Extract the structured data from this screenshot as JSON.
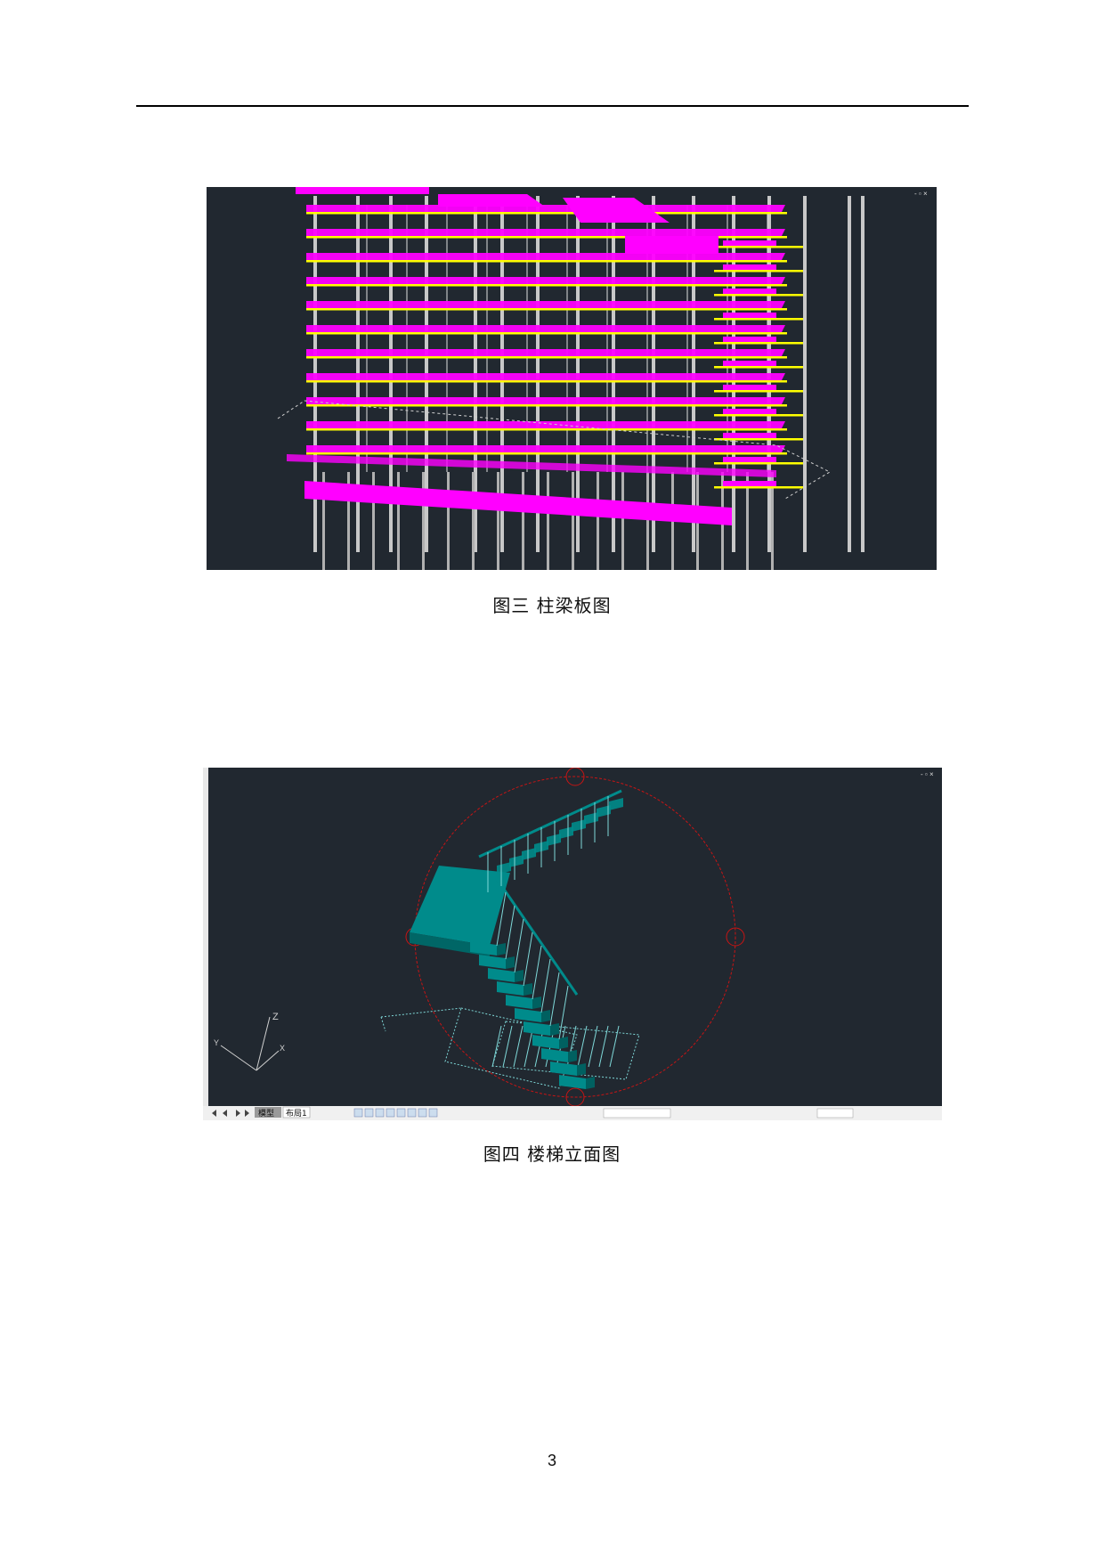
{
  "figures": [
    {
      "caption": "图三  柱梁板图",
      "viewport_bg": "#212830",
      "slab_color": "#ff00ff",
      "beam_color": "#ffff00",
      "column_color": "#c8c8c8",
      "window_controls": "- ▫ ×"
    },
    {
      "caption": "图四  楼梯立面图",
      "viewport_bg": "#212830",
      "stair_color": "#008b8b",
      "orbit_color": "#c81414",
      "axis_label_z": "Z",
      "axis_label_y": "Y",
      "axis_label_x": "X",
      "window_controls": "- ▫ ×",
      "tabs": [
        "模型",
        "布局1"
      ]
    }
  ],
  "page_number": "3"
}
